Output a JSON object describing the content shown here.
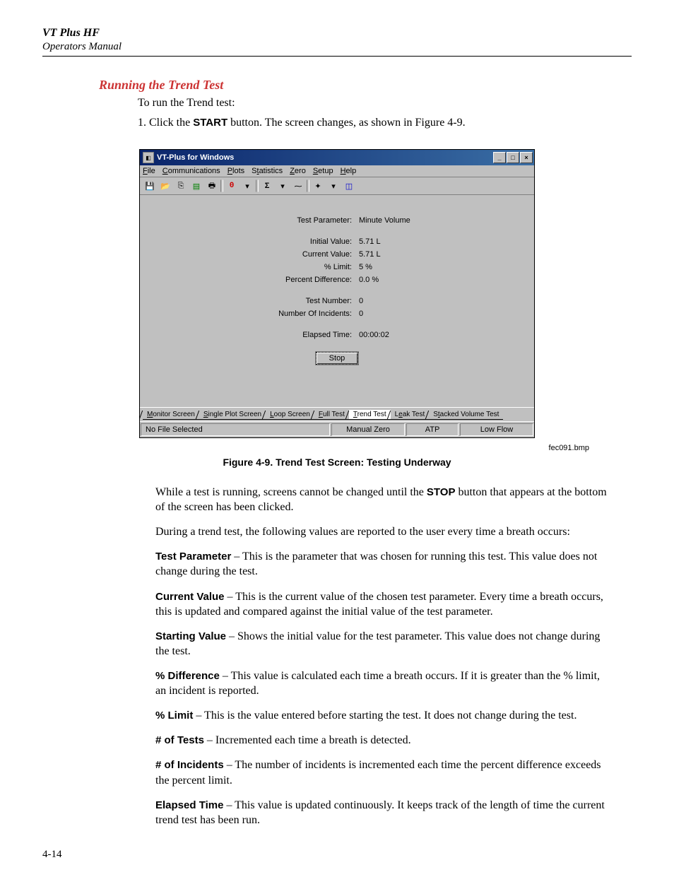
{
  "header": {
    "title": "VT Plus HF",
    "subtitle": "Operators Manual"
  },
  "section_title": "Running the Trend Test",
  "intro": "To run the Trend test:",
  "step1_prefix": "1.   Click the ",
  "step1_bold": "START",
  "step1_suffix": " button. The screen changes, as shown in Figure 4-9.",
  "window": {
    "title": "VT-Plus for Windows",
    "menus": [
      "File",
      "Communications",
      "Plots",
      "Statistics",
      "Zero",
      "Setup",
      "Help"
    ],
    "params": {
      "test_parameter_label": "Test Parameter:",
      "test_parameter_value": "Minute Volume",
      "initial_value_label": "Initial Value:",
      "initial_value_value": "5.71 L",
      "current_value_label": "Current Value:",
      "current_value_value": "5.71 L",
      "pct_limit_label": "% Limit:",
      "pct_limit_value": "5 %",
      "pct_diff_label": "Percent Difference:",
      "pct_diff_value": "0.0 %",
      "test_number_label": "Test Number:",
      "test_number_value": "0",
      "num_incidents_label": "Number Of Incidents:",
      "num_incidents_value": "0",
      "elapsed_label": "Elapsed Time:",
      "elapsed_value": "00:00:02"
    },
    "stop_label": "Stop",
    "tabs": [
      "Monitor Screen",
      "Single Plot Screen",
      "Loop Screen",
      "Full Test",
      "Trend Test",
      "Leak Test",
      "Stacked Volume Test"
    ],
    "active_tab_index": 4,
    "status": {
      "file": "No File Selected",
      "zero": "Manual Zero",
      "atp": "ATP",
      "flow": "Low Flow"
    }
  },
  "bmp_label": "fec091.bmp",
  "figure_caption": "Figure 4-9. Trend Test Screen: Testing Underway",
  "paras": {
    "p1a": "While a test is running, screens cannot be changed until the ",
    "p1b": "STOP",
    "p1c": " button that appears at the bottom of the screen has been clicked.",
    "p2": "During a trend test, the following values are reported to the user every time a breath occurs:",
    "tp_b": "Test Parameter",
    "tp_t": " – This is the parameter that was chosen for running this test. This value does not change during the test.",
    "cv_b": "Current Value",
    "cv_t": " – This is the current value of the chosen test parameter. Every time a breath occurs, this is updated and compared against the initial value of the test parameter.",
    "sv_b": "Starting Value",
    "sv_t": " – Shows the initial value for the test parameter. This value does not change during the test.",
    "pd_b": "% Difference",
    "pd_t": " – This value is calculated each time a breath occurs. If it is greater than the % limit, an incident is reported.",
    "pl_b": "% Limit",
    "pl_t": " – This is the value entered before starting the test. It does not change during the test.",
    "nt_b": "# of Tests",
    "nt_t": " – Incremented each time a breath is detected.",
    "ni_b": "# of Incidents",
    "ni_t": " – The number of incidents is incremented each time the percent difference exceeds the percent limit.",
    "et_b": "Elapsed Time",
    "et_t": " – This value is updated continuously. It keeps track of the length of time the current trend test has been run."
  },
  "page_number": "4-14"
}
